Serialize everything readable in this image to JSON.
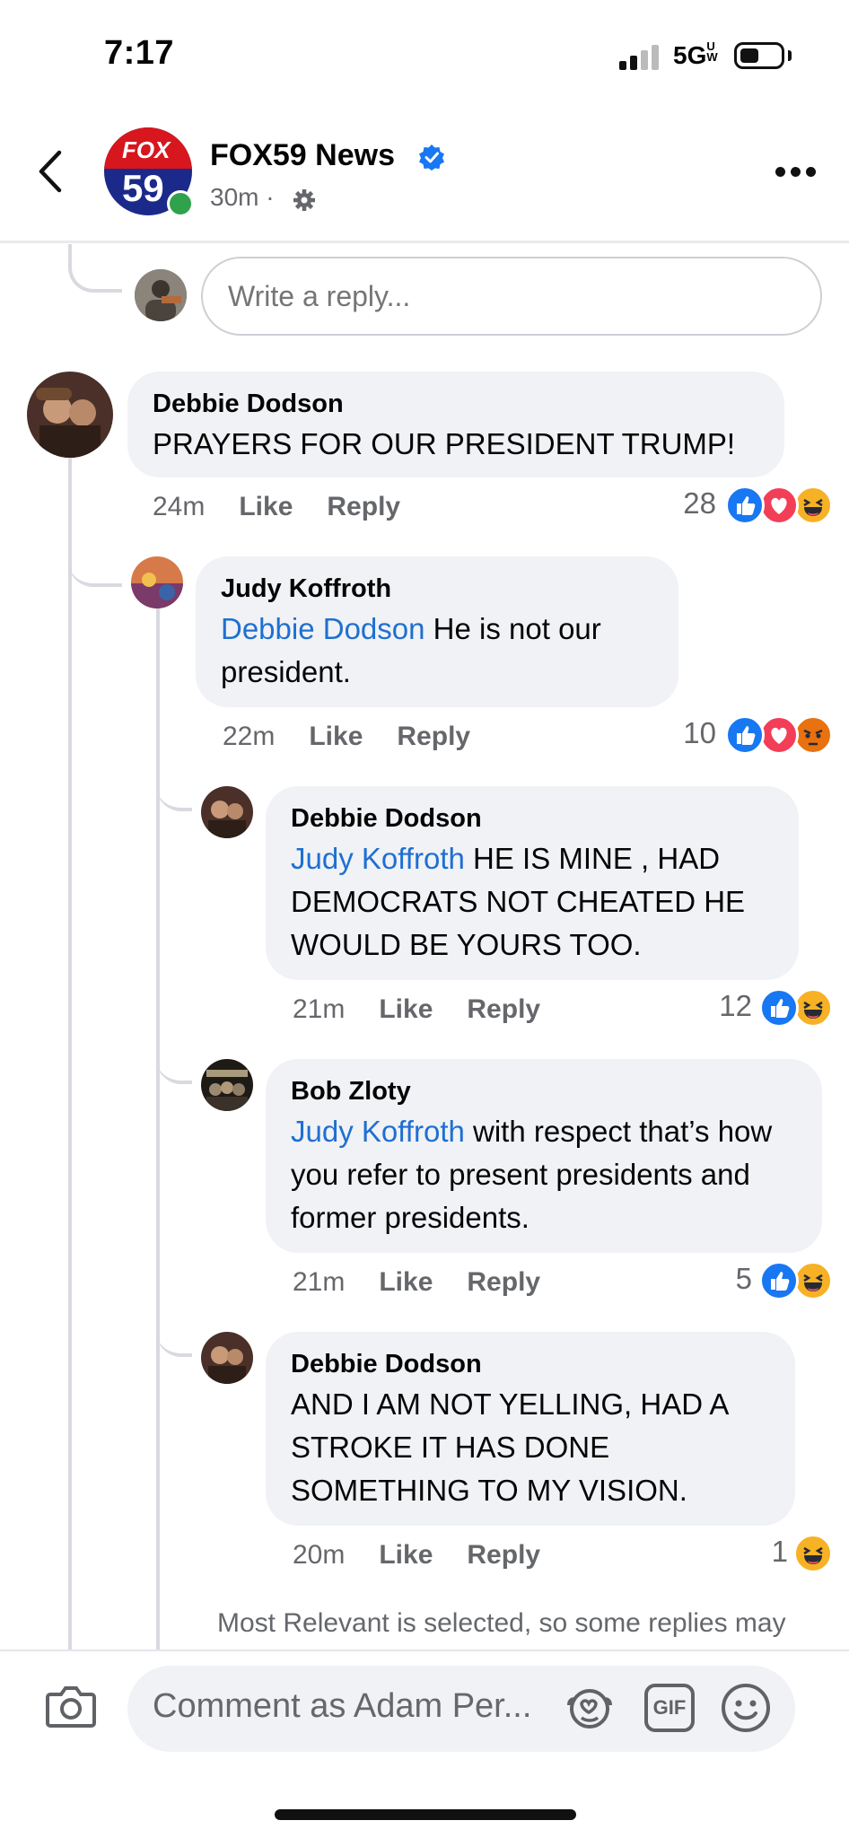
{
  "status_bar": {
    "time": "7:17",
    "network": "5G",
    "network_sup": "UW"
  },
  "header": {
    "page_name": "FOX59 News",
    "time_ago": "30m",
    "separator": "·",
    "logo_top": "FOX",
    "logo_num": "59"
  },
  "reply_box": {
    "placeholder": "Write a reply..."
  },
  "comments": [
    {
      "author": "Debbie Dodson",
      "mention": "",
      "text": "PRAYERS FOR OUR PRESIDENT TRUMP!",
      "time": "24m",
      "like": "Like",
      "reply": "Reply",
      "reactions_count": "28",
      "reactions": [
        "like",
        "love",
        "haha"
      ]
    },
    {
      "author": "Judy Koffroth",
      "mention": "Debbie Dodson",
      "text": " He is not our president.",
      "time": "22m",
      "like": "Like",
      "reply": "Reply",
      "reactions_count": "10",
      "reactions": [
        "like",
        "love",
        "angry"
      ]
    },
    {
      "author": "Debbie Dodson",
      "mention": "Judy Koffroth",
      "text": " HE IS MINE , HAD DEMOCRATS NOT CHEATED HE WOULD BE YOURS TOO.",
      "time": "21m",
      "like": "Like",
      "reply": "Reply",
      "reactions_count": "12",
      "reactions": [
        "like",
        "haha"
      ]
    },
    {
      "author": "Bob Zloty",
      "mention": "Judy Koffroth",
      "text": " with respect that’s how you refer to present presidents and former presidents.",
      "time": "21m",
      "like": "Like",
      "reply": "Reply",
      "reactions_count": "5",
      "reactions": [
        "like",
        "haha"
      ]
    },
    {
      "author": "Debbie Dodson",
      "mention": "",
      "text": "AND I AM NOT YELLING, HAD A STROKE IT HAS DONE SOMETHING TO MY VISION.",
      "time": "20m",
      "like": "Like",
      "reply": "Reply",
      "reactions_count": "1",
      "reactions": [
        "haha"
      ]
    }
  ],
  "notice": "Most Relevant is selected, so some replies may",
  "footer": {
    "comment_placeholder": "Comment as Adam Per...",
    "gif_label": "GIF"
  },
  "colors": {
    "accent": "#1877f2",
    "mention": "#1f6fd1",
    "bubble": "#f0f2f5",
    "love": "#f33e58",
    "haha": "#f7b125",
    "angry": "#e9710f"
  }
}
